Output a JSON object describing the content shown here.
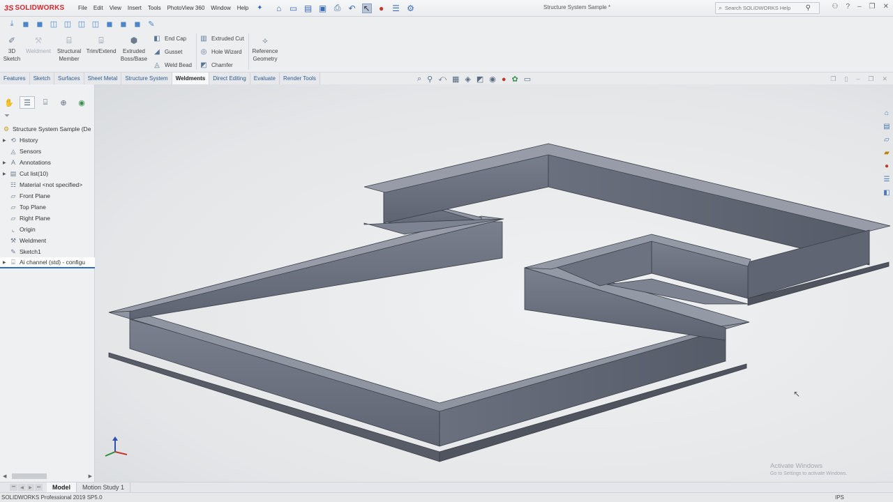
{
  "app": {
    "logo_ds": "3S",
    "logo_text": "SOLIDWORKS",
    "document_title": "Structure System Sample *",
    "search_placeholder": "Search SOLIDWORKS Help"
  },
  "menu": [
    "File",
    "Edit",
    "View",
    "Insert",
    "Tools",
    "PhotoView 360",
    "Window",
    "Help"
  ],
  "ribbon": {
    "sketch3d": "3D Sketch",
    "weldment": "Weldment",
    "structural_member": "Structural Member",
    "trim_extend": "Trim/Extend",
    "extruded_boss": "Extruded Boss/Base",
    "end_cap": "End Cap",
    "gusset": "Gusset",
    "weld_bead": "Weld Bead",
    "extruded_cut": "Extruded Cut",
    "hole_wizard": "Hole Wizard",
    "chamfer": "Chamfer",
    "reference_geometry": "Reference Geometry"
  },
  "tabs": [
    "Features",
    "Sketch",
    "Surfaces",
    "Sheet Metal",
    "Structure System",
    "Weldments",
    "Direct Editing",
    "Evaluate",
    "Render Tools"
  ],
  "active_tab": "Weldments",
  "tree": {
    "root": "Structure System Sample (De",
    "items": [
      {
        "label": "History",
        "icon": "history-icon",
        "expand": true
      },
      {
        "label": "Sensors",
        "icon": "sensors-icon",
        "expand": false
      },
      {
        "label": "Annotations",
        "icon": "annotations-icon",
        "expand": true
      },
      {
        "label": "Cut list(10)",
        "icon": "cut-list-icon",
        "expand": true
      },
      {
        "label": "Material <not specified>",
        "icon": "material-icon",
        "expand": false
      },
      {
        "label": "Front Plane",
        "icon": "plane-icon",
        "expand": false
      },
      {
        "label": "Top Plane",
        "icon": "plane-icon",
        "expand": false
      },
      {
        "label": "Right Plane",
        "icon": "plane-icon",
        "expand": false
      },
      {
        "label": "Origin",
        "icon": "origin-icon",
        "expand": false
      },
      {
        "label": "Weldment",
        "icon": "weldment-icon",
        "expand": false
      },
      {
        "label": "Sketch1",
        "icon": "sketch-icon",
        "expand": false
      },
      {
        "label": "Ai channel (std) - configu",
        "icon": "structure-icon",
        "expand": true
      }
    ]
  },
  "bottom_tabs": [
    "Model",
    "Motion Study 1"
  ],
  "status": {
    "product": "SOLIDWORKS Professional 2019 SP5.0",
    "units": "IPS"
  },
  "watermark": {
    "line1": "Activate Windows",
    "line2": "Go to Settings to activate Windows."
  },
  "colors": {
    "brand": "#d8262d",
    "model_face": "#6b7180",
    "model_top": "#8d93a0",
    "model_edge": "#3a3f48",
    "link_tab": "#315b8f",
    "selection": "#2e6bc4"
  }
}
